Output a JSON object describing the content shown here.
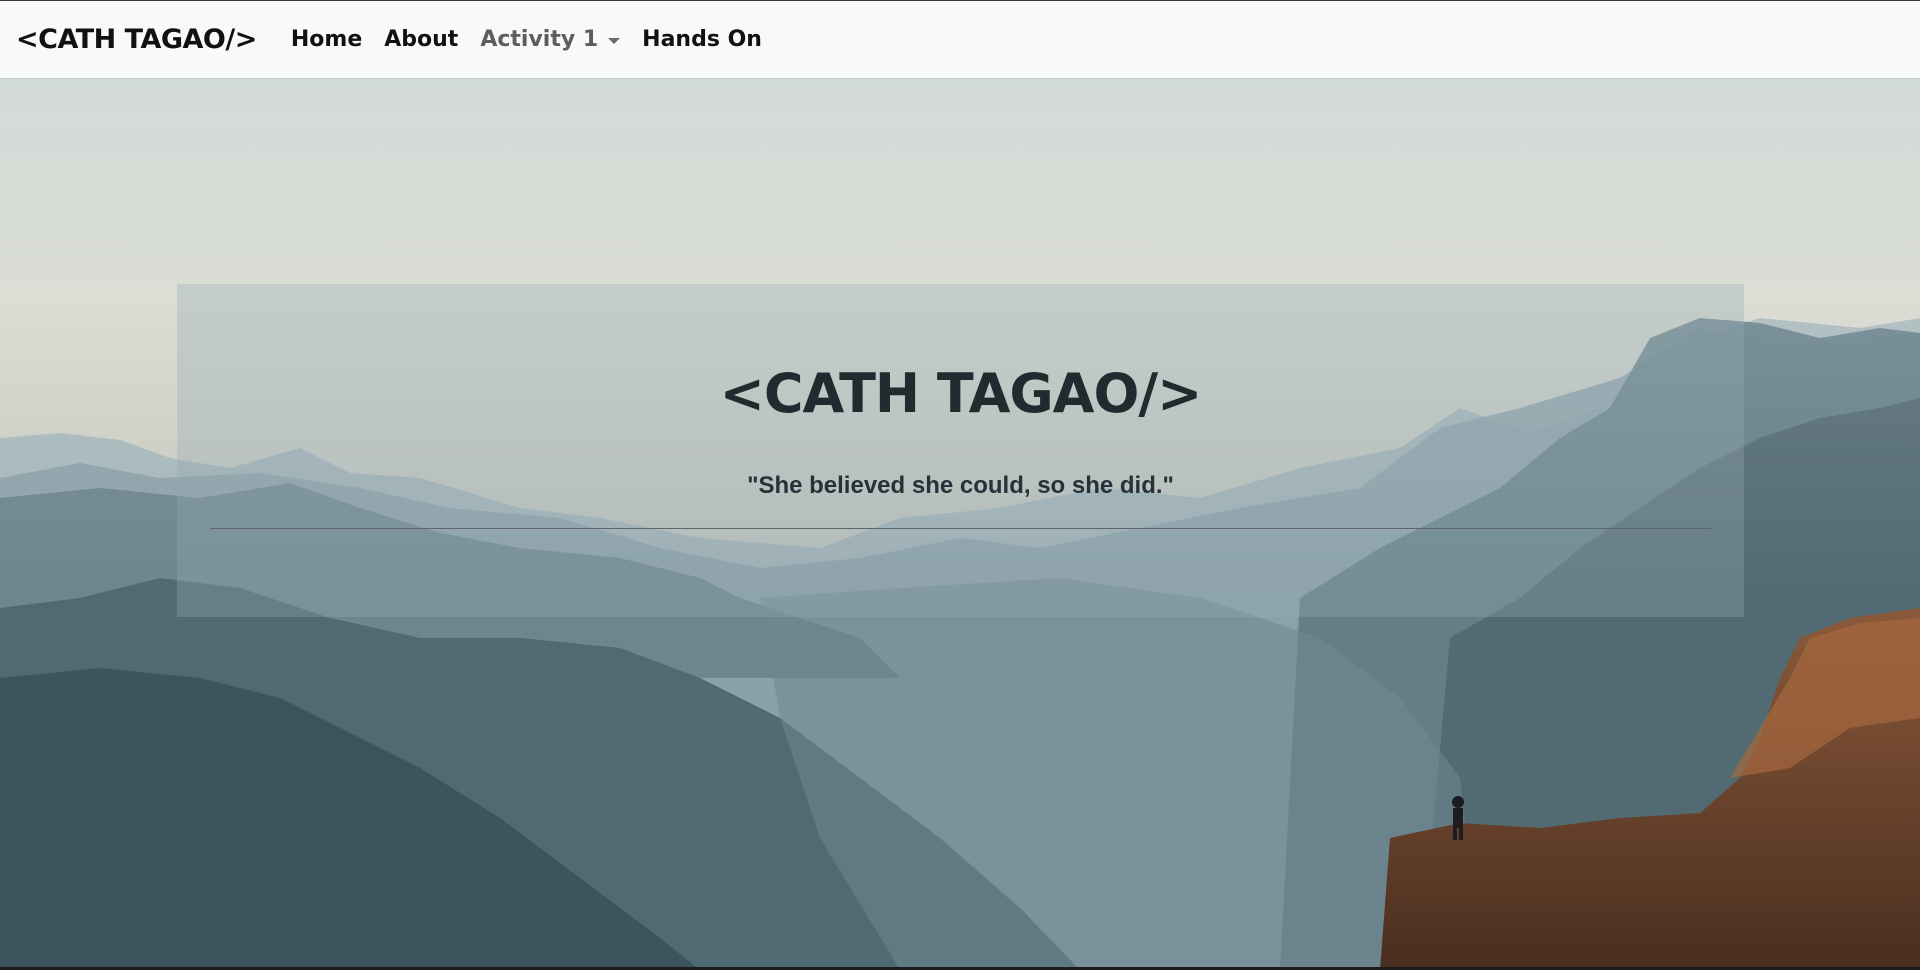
{
  "navbar": {
    "brand": "<CATH TAGAO/>",
    "links": [
      {
        "label": "Home"
      },
      {
        "label": "About"
      },
      {
        "label": "Activity 1"
      },
      {
        "label": "Hands On"
      }
    ]
  },
  "hero": {
    "title": "<CATH TAGAO/>",
    "quote": "\"She believed she could, so she did.\""
  },
  "colors": {
    "navbar_bg": "#f8f9fa",
    "text_dark": "#111111",
    "muted_link": "#5d5d5d"
  }
}
